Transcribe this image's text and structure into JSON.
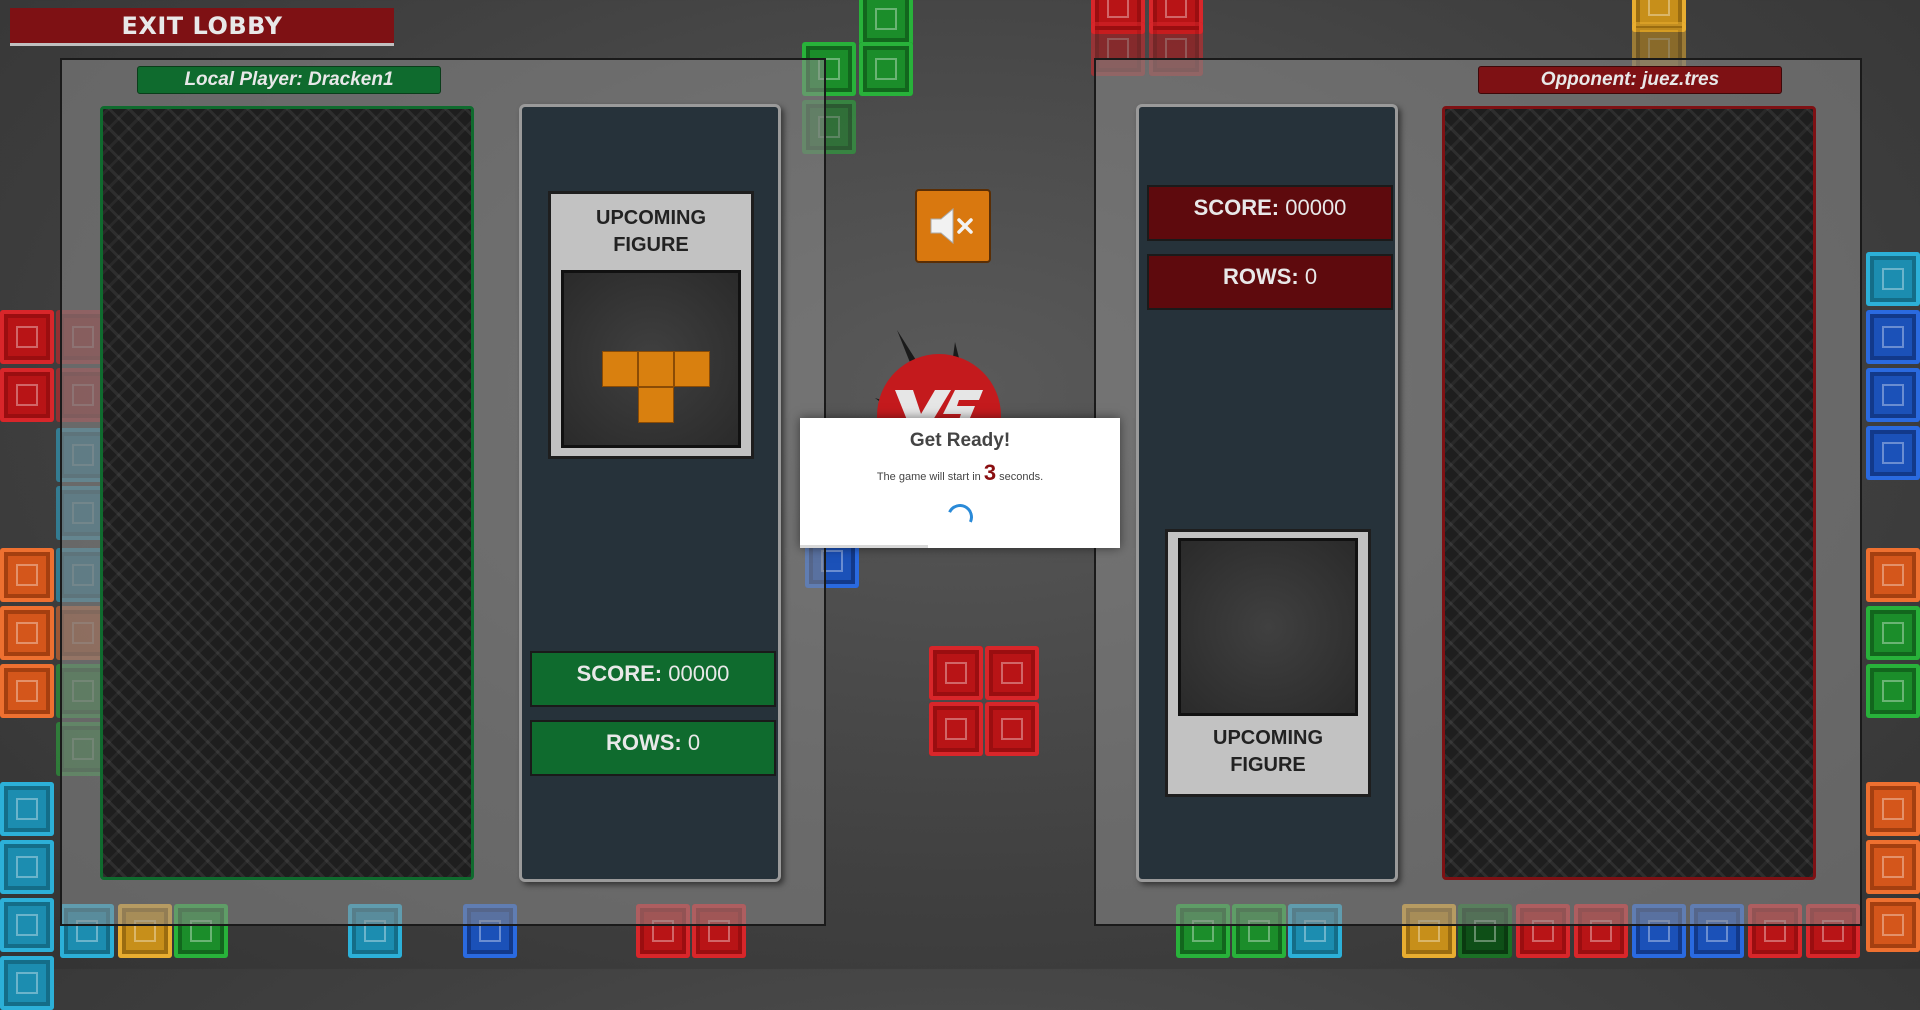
{
  "lobby": {
    "exit_label": "EXIT LOBBY"
  },
  "local": {
    "name": "Local Player: Dracken1",
    "score_label": "SCORE:",
    "score_value": " 00000",
    "rows_label": "ROWS:",
    "rows_value": " 0",
    "upcoming_line1": "UPCOMING",
    "upcoming_line2": "FIGURE",
    "upcoming_piece": "T",
    "theme_color": "#0f6b2e"
  },
  "opponent": {
    "name": "Opponent: juez.tres",
    "score_label": "SCORE:",
    "score_value": " 00000",
    "rows_label": "ROWS:",
    "rows_value": " 0",
    "upcoming_line1": "UPCOMING",
    "upcoming_line2": "FIGURE",
    "theme_color": "#7e1114"
  },
  "controls": {
    "mute_icon": "speaker-muted-icon"
  },
  "modal": {
    "title": "Get Ready!",
    "text_before": "The game will start in ",
    "countdown": "3",
    "text_after": " seconds."
  },
  "colors": {
    "local_accent": "#0f6b2e",
    "opponent_accent": "#7e1114",
    "mute_button": "#d9780f",
    "upcoming_piece": "#d9800f"
  }
}
